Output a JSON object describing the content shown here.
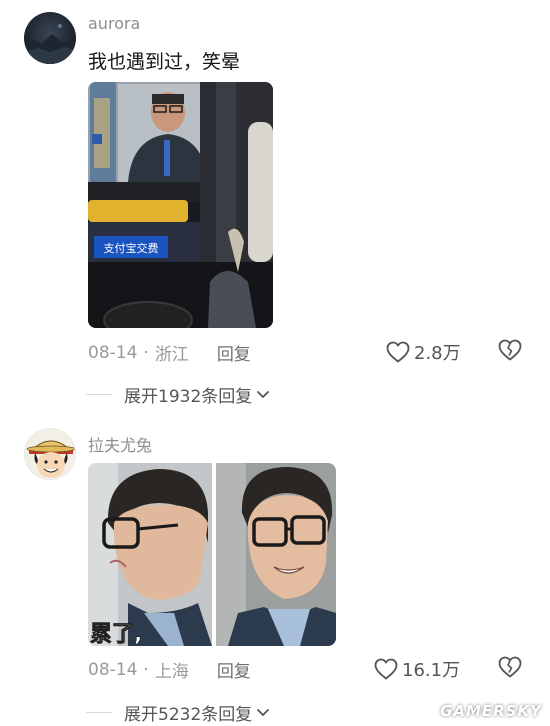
{
  "comments": [
    {
      "username": "aurora",
      "text": "我也遇到过，笑晕",
      "photo_sign": "支付宝交费",
      "date": "08-14",
      "separator": "·",
      "location": "浙江",
      "reply_label": "回复",
      "likes": "2.8万",
      "expand_label": "展开1932条回复"
    },
    {
      "username": "拉夫尤兔",
      "photo_caption": "累了,",
      "date": "08-14",
      "separator": "·",
      "location": "上海",
      "reply_label": "回复",
      "likes": "16.1万",
      "expand_label": "展开5232条回复"
    }
  ],
  "watermark": "GAMERSKY",
  "colors": {
    "meta_gray": "#9a9a9a",
    "username_gray": "#8e8e8e",
    "text_dark": "#161616"
  },
  "icons": [
    "heart-icon",
    "broken-heart-icon",
    "chevron-down-icon"
  ]
}
